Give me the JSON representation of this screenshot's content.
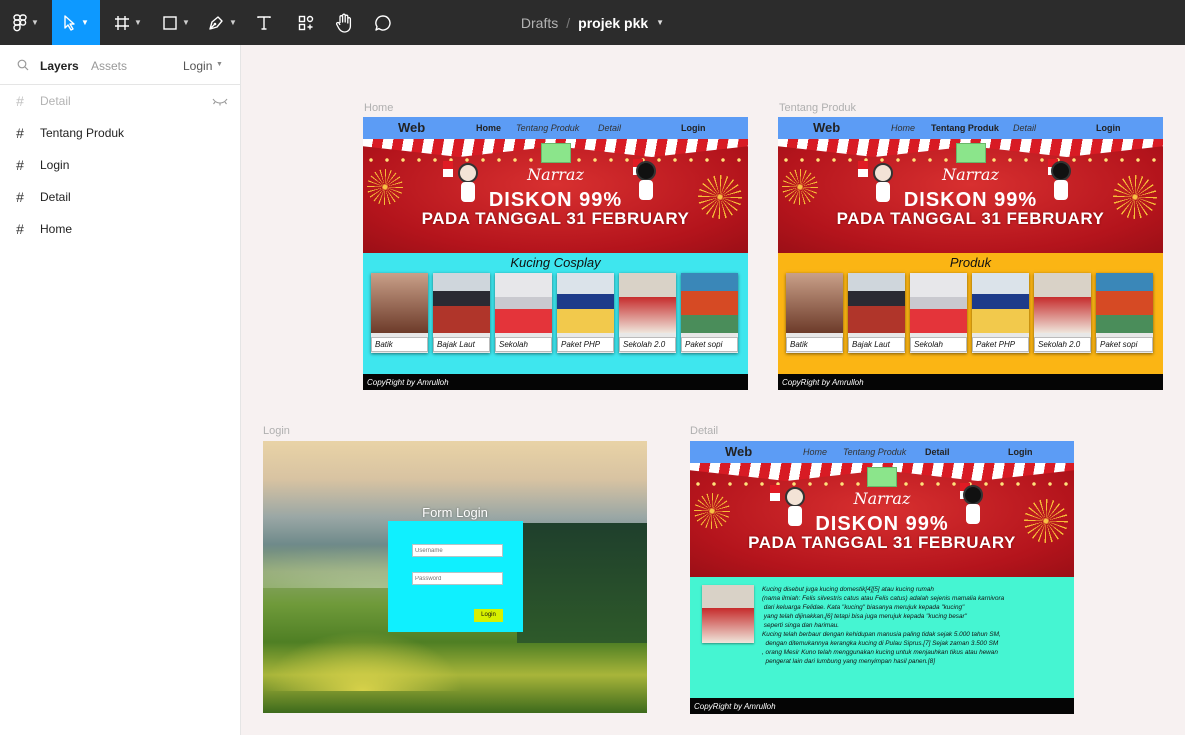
{
  "toolbar": {
    "breadcrumb_parent": "Drafts",
    "breadcrumb_sep": "/",
    "file_name": "projek pkk"
  },
  "panel": {
    "tab_layers": "Layers",
    "tab_assets": "Assets",
    "page_select": "Login",
    "layers": [
      {
        "label": "Detail",
        "hidden": true
      },
      {
        "label": "Tentang Produk",
        "hidden": false
      },
      {
        "label": "Login",
        "hidden": false
      },
      {
        "label": "Detail",
        "hidden": false
      },
      {
        "label": "Home",
        "hidden": false
      }
    ]
  },
  "site": {
    "logo": "Web",
    "nav_home": "Home",
    "nav_tentang": "Tentang Produk",
    "nav_detail": "Detail",
    "nav_login": "Login",
    "banner_brand": "Narraz",
    "banner_discount": "DISKON 99%",
    "banner_date": "PADA TANGGAL 31 FEBRUARY",
    "footer": "CopyRight by Amrulloh",
    "products": [
      "Batik",
      "Bajak Laut",
      "Sekolah",
      "Paket PHP",
      "Sekolah 2.0",
      "Paket sopi"
    ]
  },
  "frames": {
    "home": {
      "label": "Home",
      "section_title": "Kucing Cosplay",
      "section_color": "#3ee6ee"
    },
    "tentang": {
      "label": "Tentang Produk",
      "section_title": "Produk",
      "section_color": "#fbb514"
    },
    "login": {
      "label": "Login",
      "form_title": "Form Login",
      "username_placeholder": "Username",
      "password_placeholder": "Password",
      "button": "Login",
      "form_color": "#0ff0ff"
    },
    "detail": {
      "label": "Detail",
      "section_color": "#45f5d2",
      "text_lines": [
        "Kucing disebut juga kucing domestik[4][5] atau kucing rumah",
        "(nama ilmiah: Felis silvestris catus atau Felis catus) adalah sejenis mamalia karnivora",
        " dari keluarga Felidae. Kata \"kucing\" biasanya merujuk kepada \"kucing\"",
        " yang telah dijinakkan,[6] tetapi bisa juga merujuk kepada \"kucing besar\"",
        " seperti singa dan harimau.",
        "Kucing telah berbaur dengan kehidupan manusia paling tidak sejak 5.000 tahun SM,",
        "  dengan ditemukannya kerangka kucing di Pulau Siprus.[7] Sejak zaman 3.500 SM",
        ", orang Mesir Kuno telah menggunakan kucing untuk menjauhkan tikus atau hewan",
        "  pengerat lain dari lumbung yang menyimpan hasil panen.[8]"
      ]
    }
  },
  "colors": {
    "toolbar_bg": "#2c2c2c",
    "accent": "#0d99ff",
    "nav_bar": "#5c9cf5",
    "login_button": "#d7f000"
  },
  "icons": [
    "figma-menu-icon",
    "move-tool-icon",
    "frame-tool-icon",
    "shape-tool-icon",
    "pen-tool-icon",
    "text-tool-icon",
    "resources-icon",
    "hand-tool-icon",
    "comment-icon",
    "search-icon",
    "eye-hidden-icon",
    "hash-frame-icon",
    "chevron-down-icon"
  ]
}
